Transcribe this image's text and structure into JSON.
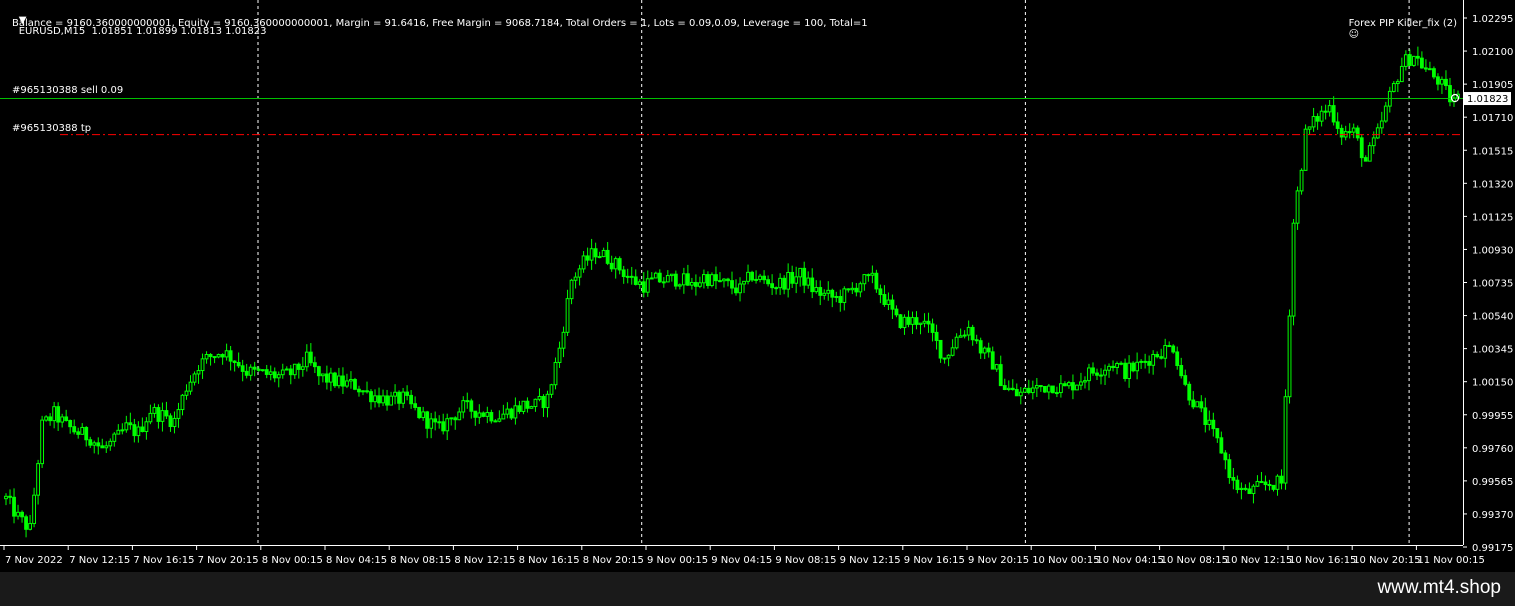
{
  "header": {
    "symbol_line": "EURUSD,M15  1.01851 1.01899 1.01813 1.01823",
    "account_line": "Balance = 9160.360000000001, Equity = 9160.360000000001, Margin = 91.6416, Free Margin = 9068.7184, Total Orders = 1, Lots = 0.09,0.09, Leverage = 100, Total=1",
    "indicator_label": "Forex PIP Killer_fix (2)"
  },
  "orders": {
    "sell_label": "#965130388 sell 0.09",
    "tp_label": "#965130388 tp",
    "sell_price": 1.01823,
    "tp_price": 1.0161
  },
  "current_price_label": "1.01823",
  "footer": {
    "watermark": "www.mt4.shop"
  },
  "colors": {
    "background": "#000000",
    "candles": "#00ff00",
    "sell_line": "#00c000",
    "tp_line": "#ff0000",
    "axis_text": "#ffffff"
  },
  "chart_data": {
    "type": "candlestick",
    "symbol": "EURUSD",
    "timeframe": "M15",
    "last_ohlc": {
      "open": 1.01851,
      "high": 1.01899,
      "low": 1.01813,
      "close": 1.01823
    },
    "y_ticks": [
      "1.02295",
      "1.02100",
      "1.01905",
      "1.01710",
      "1.01515",
      "1.01320",
      "1.01125",
      "1.00930",
      "1.00735",
      "1.00540",
      "1.00345",
      "1.00150",
      "0.99955",
      "0.99760",
      "0.99565",
      "0.99370",
      "0.99175"
    ],
    "ylim": [
      0.99175,
      1.02295
    ],
    "x_ticks": [
      "7 Nov 2022",
      "7 Nov 12:15",
      "7 Nov 16:15",
      "7 Nov 20:15",
      "8 Nov 00:15",
      "8 Nov 04:15",
      "8 Nov 08:15",
      "8 Nov 12:15",
      "8 Nov 16:15",
      "8 Nov 20:15",
      "9 Nov 00:15",
      "9 Nov 04:15",
      "9 Nov 08:15",
      "9 Nov 12:15",
      "9 Nov 16:15",
      "9 Nov 20:15",
      "10 Nov 00:15",
      "10 Nov 04:15",
      "10 Nov 08:15",
      "10 Nov 12:15",
      "10 Nov 16:15",
      "10 Nov 20:15",
      "11 Nov 00:15"
    ],
    "day_separators": [
      "8 Nov 00:00",
      "9 Nov 00:00",
      "10 Nov 00:00",
      "11 Nov 00:00"
    ],
    "closes": [
      0.9946,
      0.9935,
      0.9928,
      0.9989,
      0.9996,
      0.9989,
      0.9985,
      0.9982,
      0.9975,
      0.998,
      0.9988,
      0.9985,
      0.9998,
      0.9995,
      0.9992,
      1.0012,
      1.0025,
      1.003,
      1.0033,
      1.0028,
      1.0021,
      1.002,
      1.0019,
      1.0018,
      1.0021,
      1.0028,
      1.0018,
      1.0016,
      1.0014,
      1.0013,
      1.0008,
      1.0006,
      1.0004,
      1.0005,
      0.9998,
      0.9992,
      0.9987,
      0.9994,
      1.0,
      0.9998,
      0.9996,
      0.9995,
      0.9998,
      1.0001,
      1.0001,
      1.0005,
      1.0035,
      1.0075,
      1.0085,
      1.0092,
      1.0088,
      1.0082,
      1.0075,
      1.0072,
      1.0075,
      1.0075,
      1.0076,
      1.0071,
      1.0077,
      1.0074,
      1.0072,
      1.0069,
      1.0078,
      1.0074,
      1.0072,
      1.0075,
      1.0078,
      1.007,
      1.0066,
      1.0064,
      1.0067,
      1.0074,
      1.0075,
      1.0064,
      1.0051,
      1.005,
      1.0052,
      1.0042,
      1.0029,
      1.0041,
      1.0047,
      1.0034,
      1.0026,
      1.0012,
      1.0007,
      1.001,
      1.0012,
      1.0013,
      1.0011,
      1.0015,
      1.002,
      1.0023,
      1.0026,
      1.0021,
      1.0024,
      1.0029,
      1.0033,
      1.0036,
      1.0012,
      1.0,
      0.9988,
      0.9975,
      0.9955,
      0.9949,
      0.9952,
      0.9955,
      0.9955,
      1.0109,
      1.0161,
      1.0171,
      1.0177,
      1.0162,
      1.0162,
      1.0145,
      1.0161,
      1.0183,
      1.0202,
      1.0208,
      1.0199,
      1.0193,
      1.0182
    ]
  }
}
